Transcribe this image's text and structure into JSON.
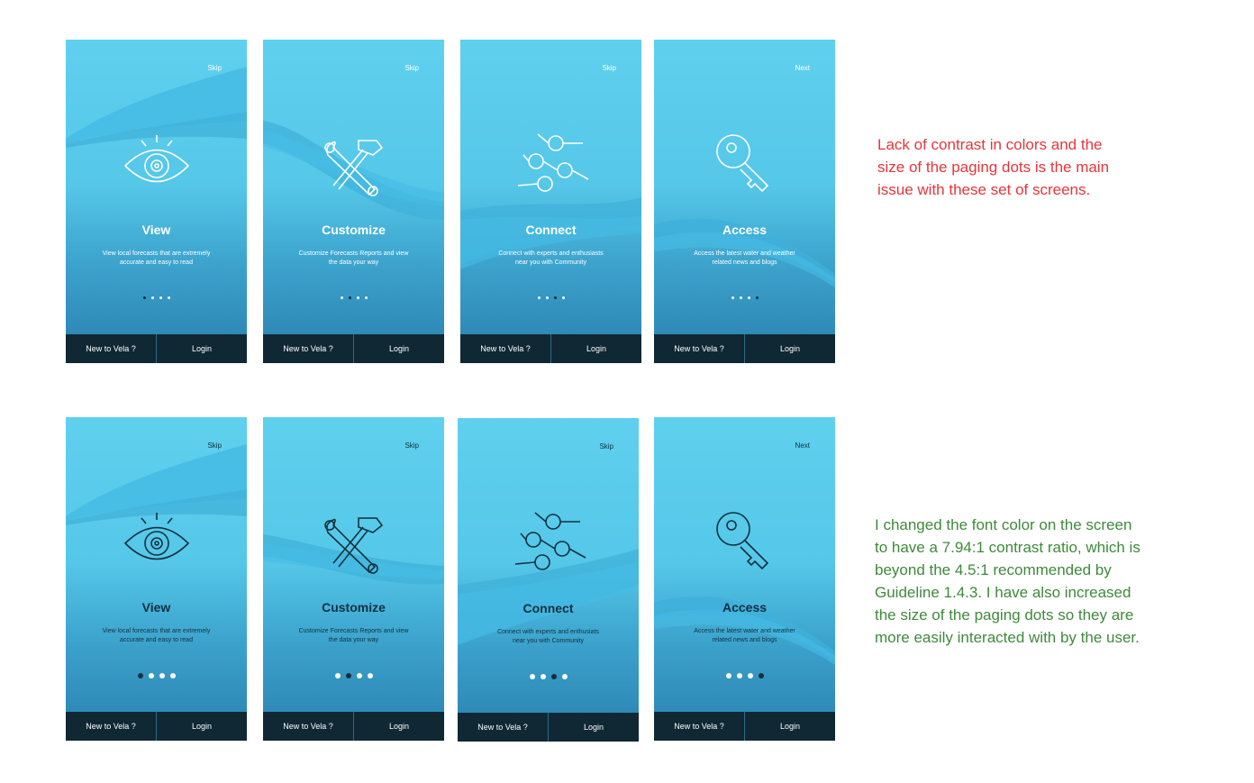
{
  "colors": {
    "accent_red": "#e8353a",
    "accent_green": "#3e8a3a",
    "footer_bg": "#0f2834",
    "screen_top": "#5fd0ee",
    "screen_bottom": "#2a7fae"
  },
  "rows": [
    {
      "screens": [
        {
          "top_link": "Skip",
          "icon": "eye-icon",
          "title": "View",
          "desc_line1": "View local forecasts that are extremely",
          "desc_line2": "accurate and easy to read",
          "active_dot": 0,
          "new_label": "New to Vela ?",
          "login_label": "Login"
        },
        {
          "top_link": "Skip",
          "icon": "tools-icon",
          "title": "Customize",
          "desc_line1": "Customize Forecasts Reports  and view",
          "desc_line2": "the data your way",
          "active_dot": 1,
          "new_label": "New to Vela ?",
          "login_label": "Login"
        },
        {
          "top_link": "Skip",
          "icon": "network-icon",
          "title": "Connect",
          "desc_line1": "Connect with experts and enthusiasts",
          "desc_line2": "near you with Community",
          "active_dot": 2,
          "new_label": "New to Vela ?",
          "login_label": "Login"
        },
        {
          "top_link": "Next",
          "icon": "key-icon",
          "title": "Access",
          "desc_line1": "Access the latest water and weather",
          "desc_line2": "related news and blogs",
          "active_dot": 3,
          "new_label": "New to Vela ?",
          "login_label": "Login"
        }
      ]
    },
    {
      "screens": [
        {
          "top_link": "Skip",
          "icon": "eye-icon",
          "title": "View",
          "desc_line1": "View local forecasts that are extremely",
          "desc_line2": "accurate and easy to read",
          "active_dot": 0,
          "new_label": "New to Vela ?",
          "login_label": "Login"
        },
        {
          "top_link": "Skip",
          "icon": "tools-icon",
          "title": "Customize",
          "desc_line1": "Customize Forecasts Reports  and view",
          "desc_line2": "the data your way",
          "active_dot": 1,
          "new_label": "New to Vela ?",
          "login_label": "Login"
        },
        {
          "top_link": "Skip",
          "icon": "network-icon",
          "title": "Connect",
          "desc_line1": "Connect with experts and enthusiats",
          "desc_line2": "near you with Community",
          "active_dot": 2,
          "new_label": "New to Vela ?",
          "login_label": "Login"
        },
        {
          "top_link": "Next",
          "icon": "key-icon",
          "title": "Access",
          "desc_line1": "Access the latest water and weather",
          "desc_line2": "related news and blogs",
          "active_dot": 3,
          "new_label": "New to Vela ?",
          "login_label": "Login"
        }
      ]
    }
  ],
  "notes": {
    "before": [
      "Lack of contrast in colors and the",
      "size of the paging dots is the main",
      "issue with these set of screens."
    ],
    "after": [
      "I changed the font color on the screen",
      "to have a 7.94:1 contrast ratio, which is",
      "beyond the 4.5:1 recommended by",
      "Guideline 1.4.3. I have also increased",
      "the size of the paging dots so they are",
      "more easily interacted with by the user."
    ]
  }
}
